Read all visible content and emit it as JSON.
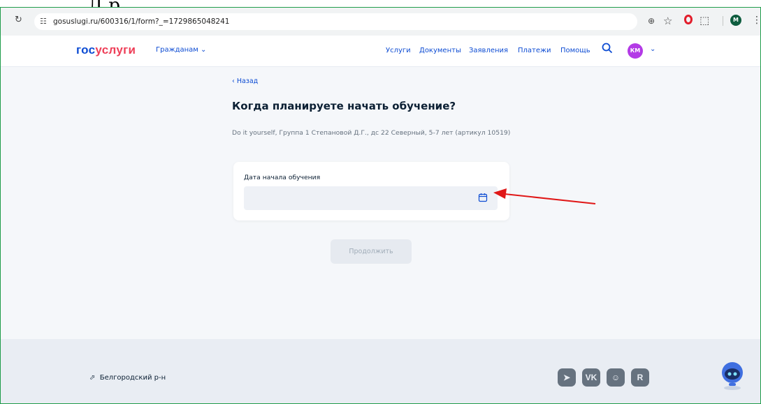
{
  "doc_fragment": "Д р",
  "browser": {
    "url": "gosuslugi.ru/600316/1/form?_=1729865048241",
    "profile_initial": "M"
  },
  "header": {
    "logo_part1": "гос",
    "logo_part2": "услуги",
    "citizens": "Гражданам ⌄",
    "nav": [
      "Услуги",
      "Документы",
      "Заявления",
      "Платежи",
      "Помощь"
    ],
    "avatar_initials": "КМ"
  },
  "main": {
    "back": "‹ Назад",
    "title": "Когда планируете начать обучение?",
    "subtitle": "Do it yourself, Группа 1 Степановой Д.Г., дс 22 Северный, 5-7 лет (артикул 10519)",
    "field_label": "Дата начала обучения",
    "field_value": "",
    "continue": "Продолжить"
  },
  "footer": {
    "location": "Белгородский р-н",
    "socials": [
      "telegram-icon",
      "vk-icon",
      "odnoklassniki-icon",
      "rutube-icon"
    ]
  },
  "colors": {
    "brand_blue": "#0d4cd3",
    "brand_red": "#ee3f58",
    "annotation_red": "#e01818"
  }
}
